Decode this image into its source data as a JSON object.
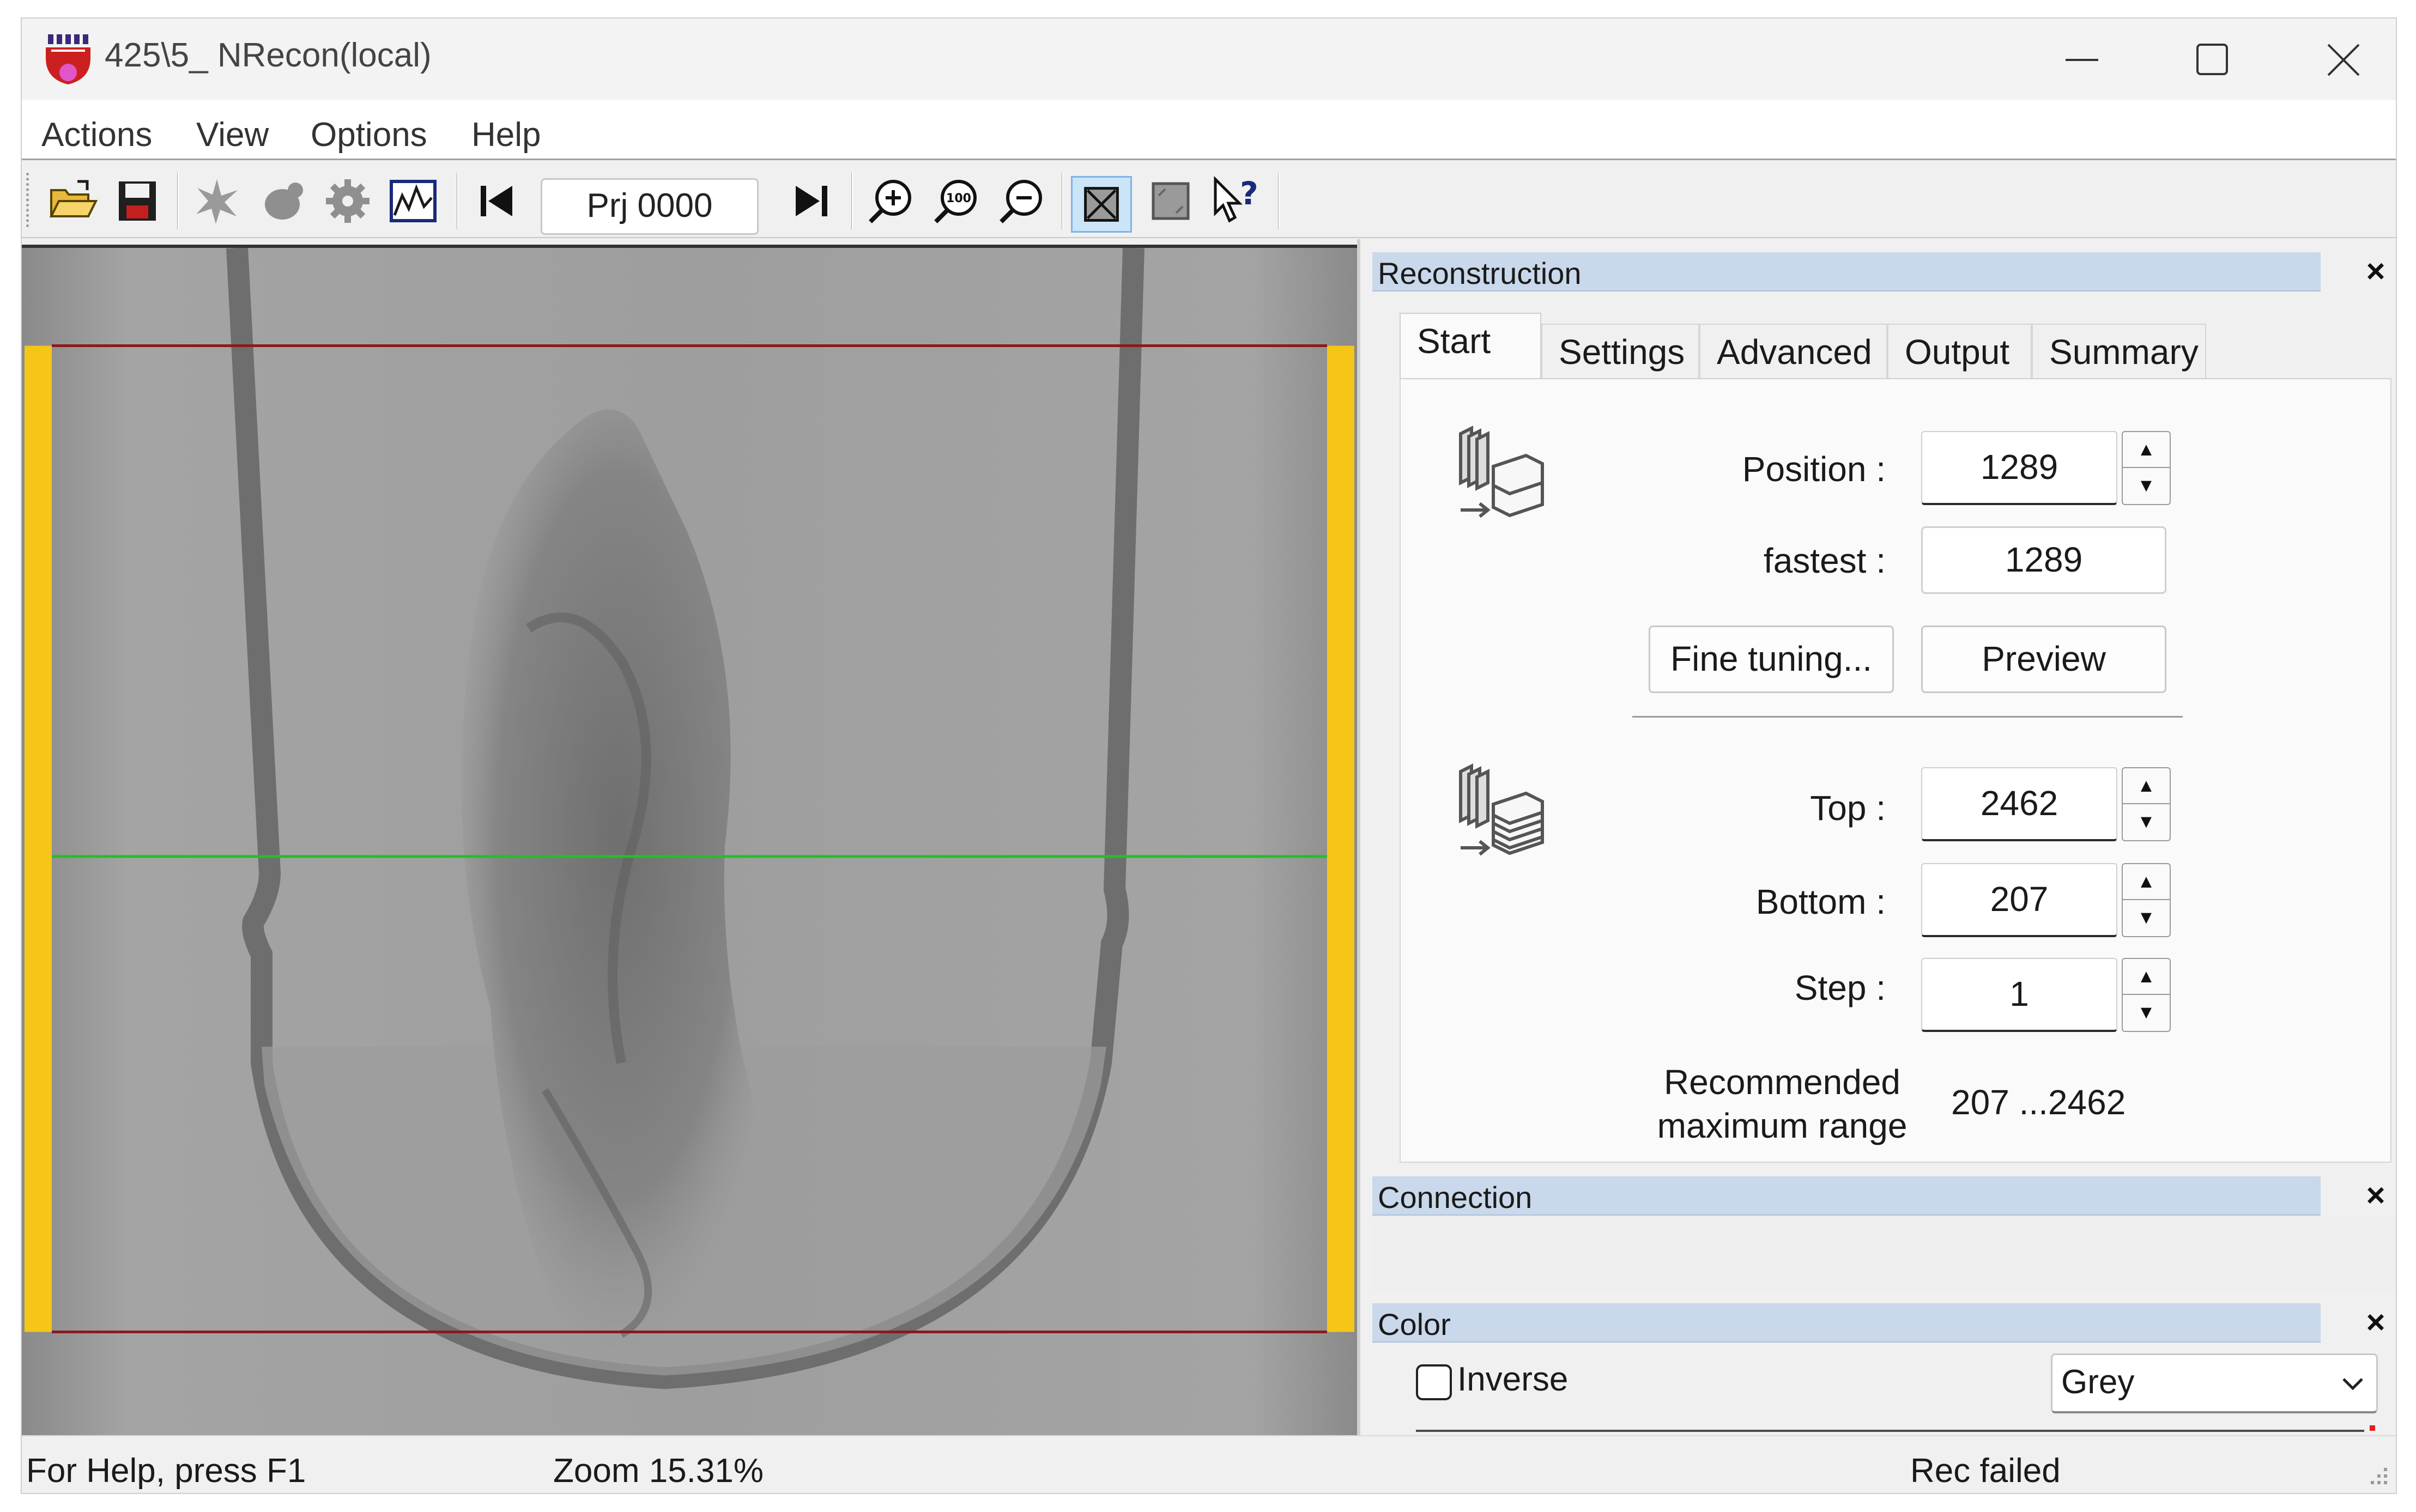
{
  "window": {
    "title": "425\\5_  NRecon(local)"
  },
  "menu": [
    "Actions",
    "View",
    "Options",
    "Help"
  ],
  "toolbar": {
    "projection_label": "Prj 0000",
    "buttons": [
      "open-folder-icon",
      "save-icon",
      "spark-icon",
      "blob-icon",
      "gear-icon",
      "histogram-icon",
      "first-frame-icon",
      "last-frame-icon",
      "zoom-in-icon",
      "zoom-100-icon",
      "zoom-out-icon",
      "fit-icon",
      "square-icon",
      "help-icon"
    ]
  },
  "viewer": {
    "colors": {
      "border_left_right": "#f5c518",
      "roi_line": "#8b1a1a",
      "position_line": "#22c022",
      "background": "#9a9a9a"
    }
  },
  "panels": {
    "reconstruction": {
      "title": "Reconstruction",
      "tabs": [
        "Start",
        "Settings",
        "Advanced",
        "Output",
        "Summary"
      ],
      "selected_tab": "Start",
      "position_label": "Position :",
      "position_value": "1289",
      "fastest_label": "fastest :",
      "fastest_value": "1289",
      "fine_tuning_label": "Fine tuning...",
      "preview_label": "Preview",
      "top_label": "Top :",
      "top_value": "2462",
      "bottom_label": "Bottom :",
      "bottom_value": "207",
      "step_label": "Step :",
      "step_value": "1",
      "recommended_line1": "Recommended",
      "recommended_line2": "maximum range",
      "recommended_value": "207 ...2462"
    },
    "connection": {
      "title": "Connection"
    },
    "color": {
      "title": "Color",
      "inverse_label": "Inverse",
      "inverse_checked": false,
      "palette": "Grey"
    }
  },
  "statusbar": {
    "help": "For Help, press F1",
    "zoom": "Zoom 15.31%",
    "state": "Rec failed"
  },
  "accent": "#c9d8ea"
}
